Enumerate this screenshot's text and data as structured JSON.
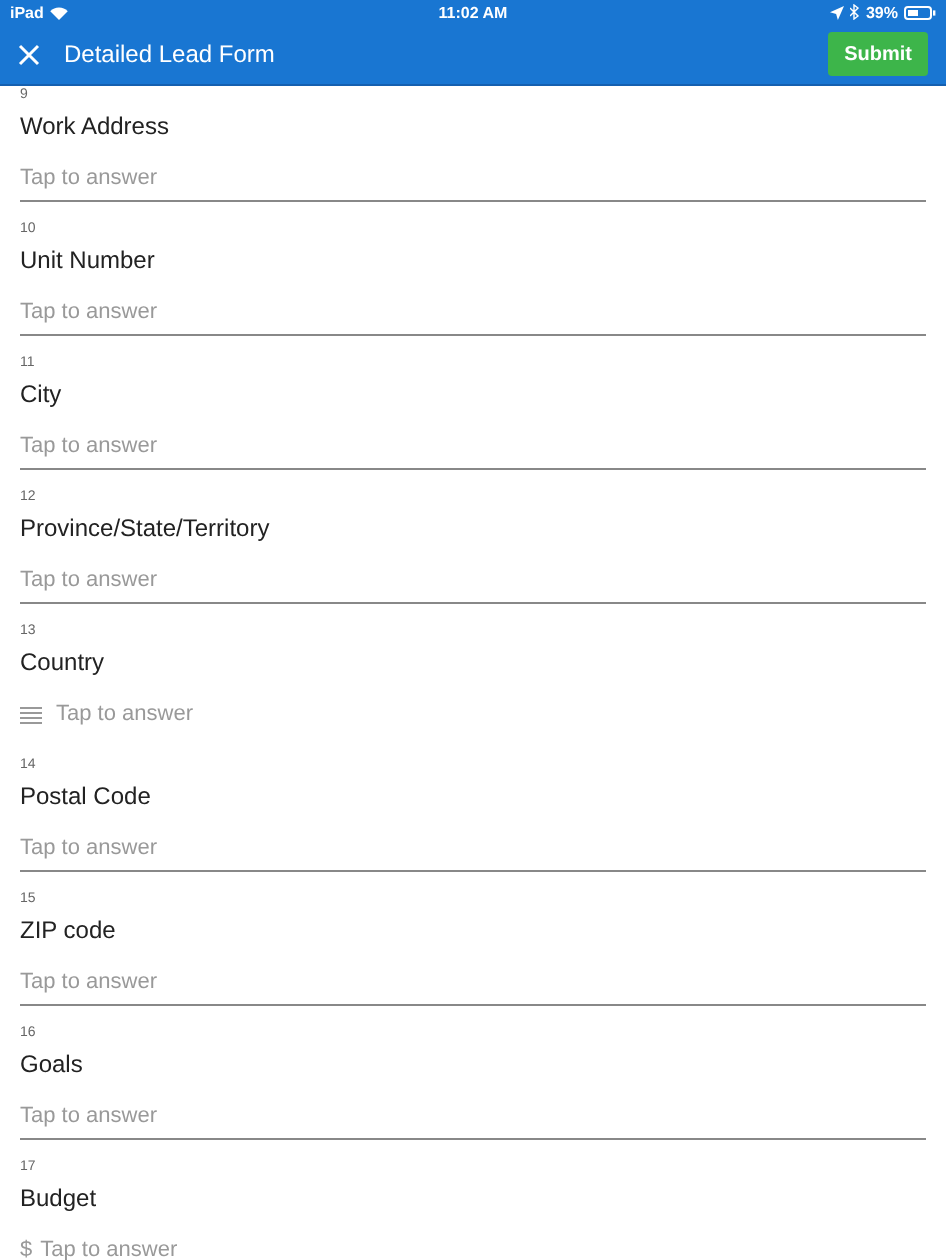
{
  "status_bar": {
    "device": "iPad",
    "time": "11:02 AM",
    "battery": "39%"
  },
  "header": {
    "title": "Detailed Lead Form",
    "submit": "Submit"
  },
  "questions": [
    {
      "number": "9",
      "label": "Work Address",
      "kind": "text",
      "placeholder": "Tap to answer"
    },
    {
      "number": "10",
      "label": "Unit Number",
      "kind": "text",
      "placeholder": "Tap to answer"
    },
    {
      "number": "11",
      "label": "City",
      "kind": "text",
      "placeholder": "Tap to answer"
    },
    {
      "number": "12",
      "label": "Province/State/Territory",
      "kind": "text",
      "placeholder": "Tap to answer"
    },
    {
      "number": "13",
      "label": "Country",
      "kind": "choice",
      "placeholder": "Tap to answer"
    },
    {
      "number": "14",
      "label": "Postal Code",
      "kind": "text",
      "placeholder": "Tap to answer"
    },
    {
      "number": "15",
      "label": "ZIP code",
      "kind": "text",
      "placeholder": "Tap to answer"
    },
    {
      "number": "16",
      "label": "Goals",
      "kind": "text",
      "placeholder": "Tap to answer"
    },
    {
      "number": "17",
      "label": "Budget",
      "kind": "currency",
      "prefix": "$",
      "placeholder": "Tap to answer"
    }
  ]
}
